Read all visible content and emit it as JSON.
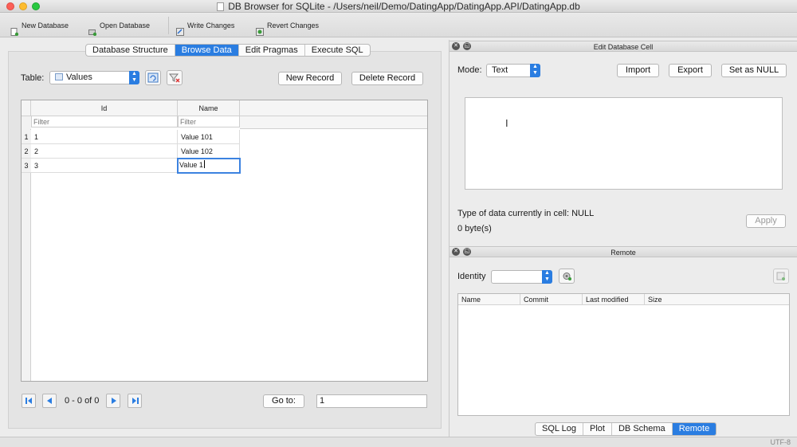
{
  "window": {
    "title": "DB Browser for SQLite - /Users/neil/Demo/DatingApp/DatingApp.API/DatingApp.db"
  },
  "toolbar": {
    "new_database": "New Database",
    "open_database": "Open Database",
    "write_changes": "Write Changes",
    "revert_changes": "Revert Changes"
  },
  "tabs": [
    "Database Structure",
    "Browse Data",
    "Edit Pragmas",
    "Execute SQL"
  ],
  "browse": {
    "table_label": "Table:",
    "table_value": "Values",
    "new_record": "New Record",
    "delete_record": "Delete Record",
    "columns": [
      "Id",
      "Name"
    ],
    "filter_placeholder": "Filter",
    "rows": [
      {
        "num": "1",
        "id": "1",
        "name": "Value 101"
      },
      {
        "num": "2",
        "id": "2",
        "name": "Value 102"
      },
      {
        "num": "3",
        "id": "3",
        "name": "Value 1"
      }
    ],
    "page_info": "0 - 0 of 0",
    "goto_label": "Go to:",
    "goto_value": "1"
  },
  "edit_cell": {
    "title": "Edit Database Cell",
    "mode_label": "Mode:",
    "mode_value": "Text",
    "import": "Import",
    "export": "Export",
    "set_null": "Set as NULL",
    "type_text": "Type of data currently in cell: NULL",
    "size_text": "0 byte(s)",
    "apply": "Apply"
  },
  "remote": {
    "title": "Remote",
    "identity_label": "Identity",
    "columns": [
      "Name",
      "Commit",
      "Last modified",
      "Size"
    ]
  },
  "bottom_tabs": [
    "SQL Log",
    "Plot",
    "DB Schema",
    "Remote"
  ],
  "status": {
    "encoding": "UTF-8"
  },
  "colors": {
    "accent": "#2a7de1"
  }
}
